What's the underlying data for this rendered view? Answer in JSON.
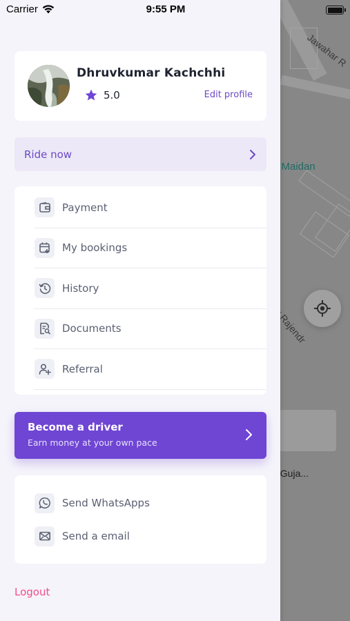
{
  "status_bar": {
    "carrier": "Carrier",
    "time": "9:55 PM"
  },
  "map": {
    "labels": {
      "road_top": "Jawahar R",
      "park": "i Maidan",
      "road_mid": "ar Rajendr",
      "bottom": ", Guja..."
    }
  },
  "profile": {
    "name": "Dhruvkumar Kachchhi",
    "rating": "5.0",
    "edit_label": "Edit profile"
  },
  "ride_now": {
    "label": "Ride now"
  },
  "menu": {
    "items": [
      {
        "label": "Payment",
        "icon": "wallet-icon"
      },
      {
        "label": "My bookings",
        "icon": "calendar-plus-icon"
      },
      {
        "label": "History",
        "icon": "history-icon"
      },
      {
        "label": "Documents",
        "icon": "document-search-icon"
      },
      {
        "label": "Referral",
        "icon": "user-add-icon"
      }
    ]
  },
  "driver_banner": {
    "title": "Become a driver",
    "subtitle": "Earn money at your own pace"
  },
  "contact": {
    "items": [
      {
        "label": "Send WhatsApps",
        "icon": "whatsapp-icon"
      },
      {
        "label": "Send a email",
        "icon": "mail-icon"
      }
    ]
  },
  "logout": {
    "label": "Logout"
  },
  "colors": {
    "accent": "#6f45d4",
    "accent_text": "#6c48c5",
    "logout": "#f24d8c",
    "drawer_bg": "#f5f4fa"
  }
}
